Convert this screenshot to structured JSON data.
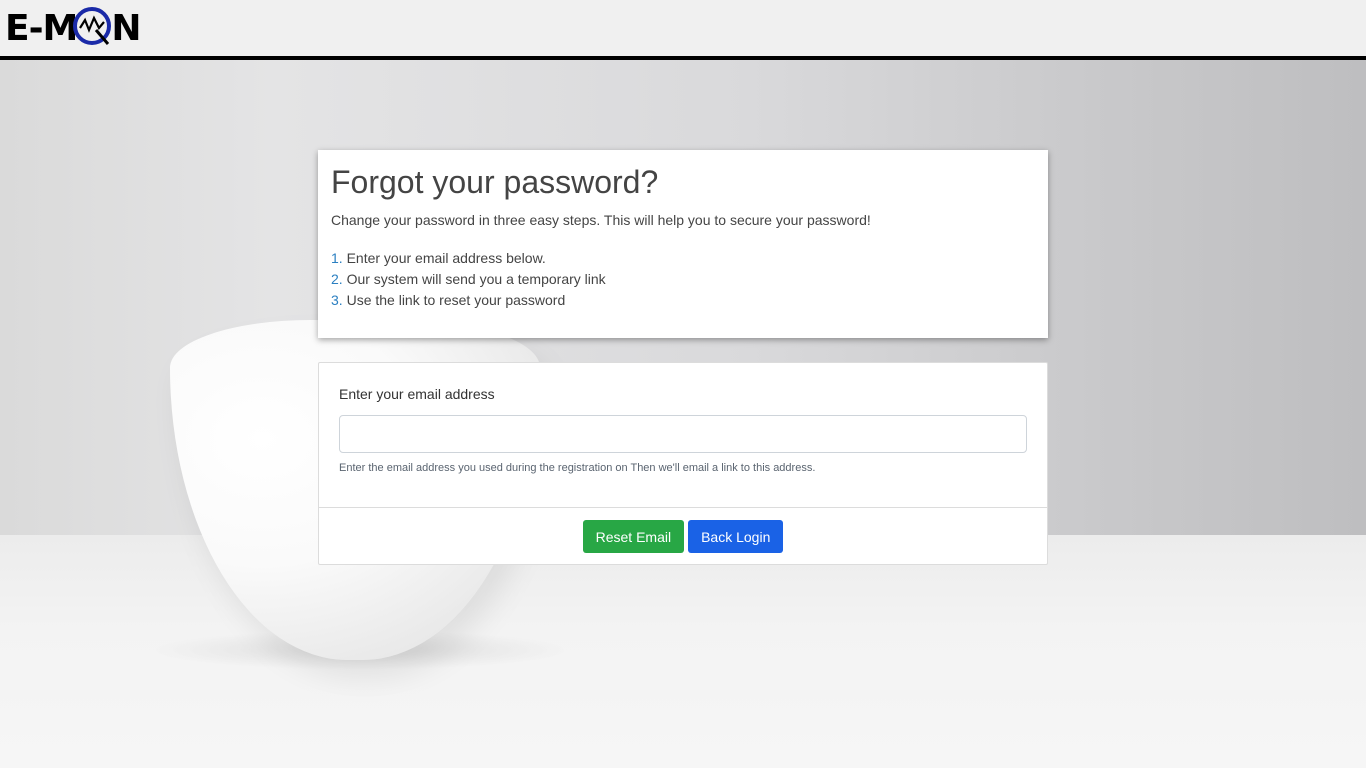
{
  "header": {
    "logo_text_left": "E-M",
    "logo_text_right": "N",
    "logo_alt": "E-MON"
  },
  "info": {
    "title": "Forgot your password?",
    "subtitle": "Change your password in three easy steps. This will help you to secure your password!",
    "steps": [
      {
        "num": "1.",
        "text": " Enter your email address below."
      },
      {
        "num": "2.",
        "text": " Our system will send you a temporary link"
      },
      {
        "num": "3.",
        "text": " Use the link to reset your password"
      }
    ]
  },
  "form": {
    "email_label": "Enter your email address",
    "email_value": "",
    "email_placeholder": "",
    "help_text": "Enter the email address you used during the registration on Then we'll email a link to this address.",
    "reset_label": "Reset Email",
    "back_label": "Back Login"
  },
  "colors": {
    "step_number": "#2a7fc1",
    "reset_button": "#28a745",
    "back_button": "#1a62e6",
    "logo_accent": "#1a2aa8"
  }
}
